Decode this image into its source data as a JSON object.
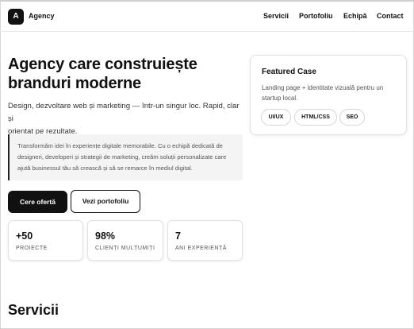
{
  "header": {
    "logo_letter": "A",
    "brand": "Agency",
    "nav": [
      "Servicii",
      "Portofoliu",
      "Echipă",
      "Contact"
    ]
  },
  "hero": {
    "title_line1": "Agency care construiește",
    "title_line2": "branduri moderne",
    "subtitle_line1": "Design, dezvoltare web și marketing — într-un singur loc. Rapid, clar și",
    "subtitle_line2": "orientat pe rezultate.",
    "quote_line1": "Transformăm idei în experiențe digitale memorabile. Cu o echipă dedicată de",
    "quote_line2": "designeri, developeri și strategii de marketing, creăm soluții personalizate care",
    "quote_line3": "ajută businessul tău să crească și să se remarce în mediul digital."
  },
  "buttons": {
    "primary": "Cere ofertă",
    "secondary": "Vezi portofoliu"
  },
  "stats": [
    {
      "value": "+50",
      "label": "PROIECTE"
    },
    {
      "value": "98%",
      "label": "CLIENȚI MULȚUMIȚI"
    },
    {
      "value": "7",
      "label": "ANI EXPERIENȚĂ"
    }
  ],
  "featured": {
    "title": "Featured Case",
    "desc_line1": "Landing page + identitate vizuală pentru un",
    "desc_line2": "startup local.",
    "tags": [
      "UI/UX",
      "HTML/CSS",
      "SEO"
    ]
  },
  "section": {
    "title": "Servicii"
  }
}
